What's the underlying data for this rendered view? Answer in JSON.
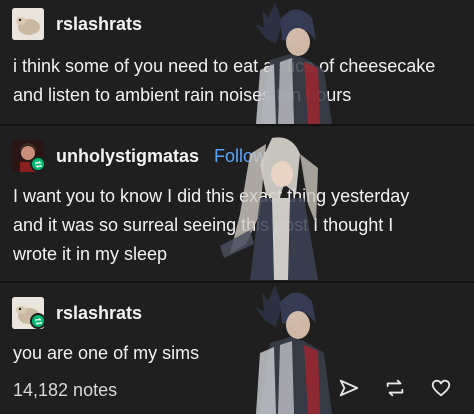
{
  "posts": [
    {
      "username": "rslashrats",
      "lines": [
        "i think some of you need to eat a slice of cheesecake",
        "and listen to ambient rain noises ten hours"
      ]
    },
    {
      "username": "unholystigmatas",
      "follow_label": "Follow",
      "lines": [
        "I want you to know I did this exact thing yesterday",
        "and it was so surreal seeing this post I thought I",
        "wrote it in my sleep"
      ]
    },
    {
      "username": "rslashrats",
      "lines": [
        "you are one of my sims"
      ]
    }
  ],
  "footer": {
    "notes": "14,182 notes",
    "icons": [
      "share-icon",
      "reblog-icon",
      "like-icon"
    ]
  },
  "colors": {
    "background": "#1f1f1f",
    "divider": "#121212",
    "text": "#f2f2f2",
    "follow": "#58a6ff",
    "reblog_badge": "#00b86b"
  }
}
